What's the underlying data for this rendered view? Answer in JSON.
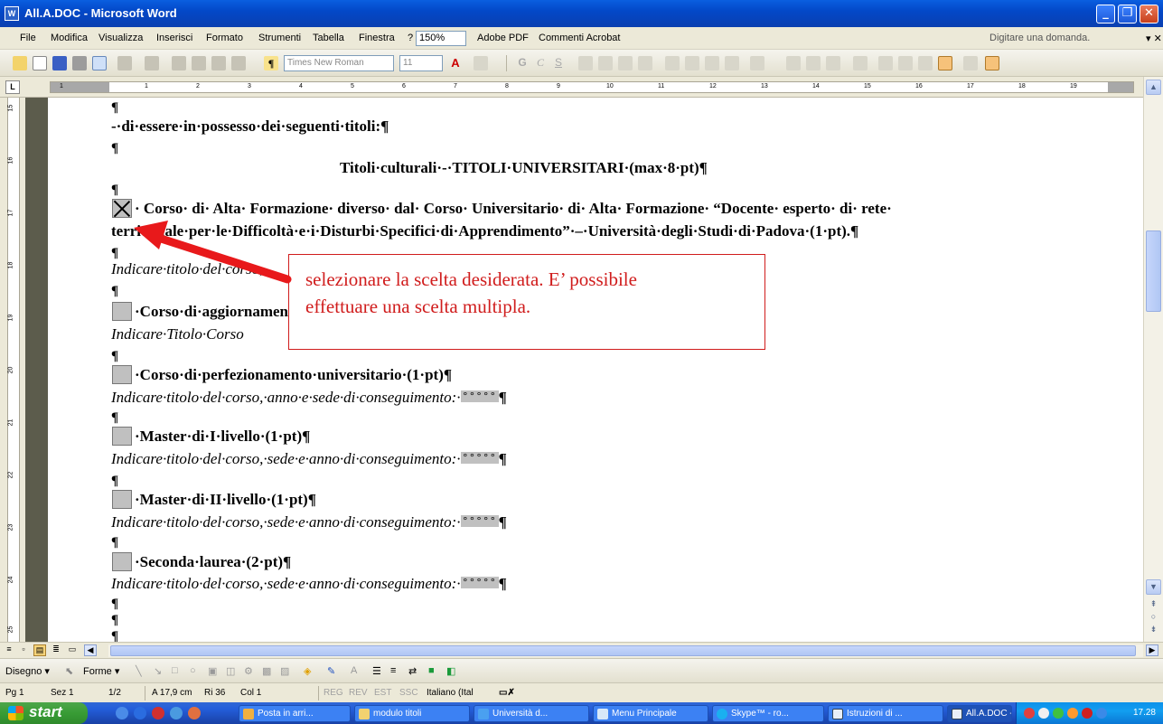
{
  "window": {
    "title": "All.A.DOC - Microsoft Word",
    "icon_name": "word-doc-icon",
    "buttons": [
      "minimize",
      "maximize",
      "close"
    ]
  },
  "menu": {
    "items": [
      "File",
      "Modifica",
      "Visualizza",
      "Inserisci",
      "Formato",
      "Strumenti",
      "Tabella",
      "Finestra",
      "?",
      "150%",
      "Adobe PDF",
      "Commenti Acrobat"
    ],
    "zoom": "150%",
    "ask_placeholder": "Digitare una domanda."
  },
  "toolbar": {
    "font_name": "Times New Roman",
    "font_size": "11"
  },
  "ruler": {
    "numbers": [
      "1",
      "1",
      "2",
      "3",
      "4",
      "5",
      "6",
      "7",
      "8",
      "9",
      "10",
      "11",
      "12",
      "13",
      "14",
      "15",
      "16",
      "17",
      "18",
      "19"
    ],
    "vertical_numbers": [
      "15",
      "16",
      "17",
      "18",
      "19",
      "20",
      "21",
      "22",
      "23",
      "24",
      "25"
    ]
  },
  "document": {
    "pilcrow": "¶",
    "intro": "-·di·essere·in·possesso·dei·seguenti·titoli:¶",
    "section_title": "Titoli·culturali·-·TITOLI·UNIVERSITARI·(max·8·pt)¶",
    "item1_line1": "· Corso· di· Alta· Formazione· diverso· dal· Corso· Universitario· di· Alta· Formazione· “Docente· esperto· di· rete·",
    "item1_line2": "territoriale·per·le·Difficoltà·e·i·Disturbi·Specifici·di·Apprendimento”·–·Università·degli·Studi·di·Padova·(1·pt).¶",
    "item1_hint": "Indicare·titolo·del·corso,",
    "item2_title": "·Corso·di·aggiornamento",
    "item2_hint": "Indicare·Titolo·Corso",
    "item3_title": "·Corso·di·perfezionamento·universitario·(1·pt)¶",
    "item3_hint": "Indicare·titolo·del·corso,·anno·e·sede·di·conseguimento:·",
    "item4_title": "·Master·di·I·livello·(1·pt)¶",
    "item4_hint": "Indicare·titolo·del·corso,·sede·e·anno·di·conseguimento:·",
    "item5_title": "·Master·di·II·livello·(1·pt)¶",
    "item5_hint": "Indicare·titolo·del·corso,·sede·e·anno·di·conseguimento:·",
    "item6_title": "·Seconda·laurea·(2·pt)¶",
    "item6_hint": "Indicare·titolo·del·corso,·sede·e·anno·di·conseguimento:·",
    "field_placeholder": "°°°°°",
    "checkbox_states": [
      true,
      false,
      false,
      false,
      false,
      false
    ]
  },
  "callout": {
    "line1": "selezionare la scelta desiderata. E’ possibile",
    "line2": "effettuare una scelta multipla.",
    "color": "#d01c1c"
  },
  "drawbar": {
    "disegno": "Disegno ▾",
    "forme": "Forme ▾"
  },
  "status": {
    "page": "Pg 1",
    "section": "Sez 1",
    "pages": "1/2",
    "position": "A 17,9 cm",
    "row": "Ri 36",
    "col": "Col 1",
    "reg": "REG",
    "rev": "REV",
    "est": "EST",
    "ssc": "SSC",
    "language": "Italiano (Ital"
  },
  "taskbar": {
    "start": "start",
    "tasks": [
      "Posta in arri...",
      "modulo titoli",
      "Università d...",
      "Menu Principale",
      "Skype™ - ro...",
      "Istruzioni di ...",
      "All.A.DOC - ..."
    ],
    "clock": "17.28"
  }
}
